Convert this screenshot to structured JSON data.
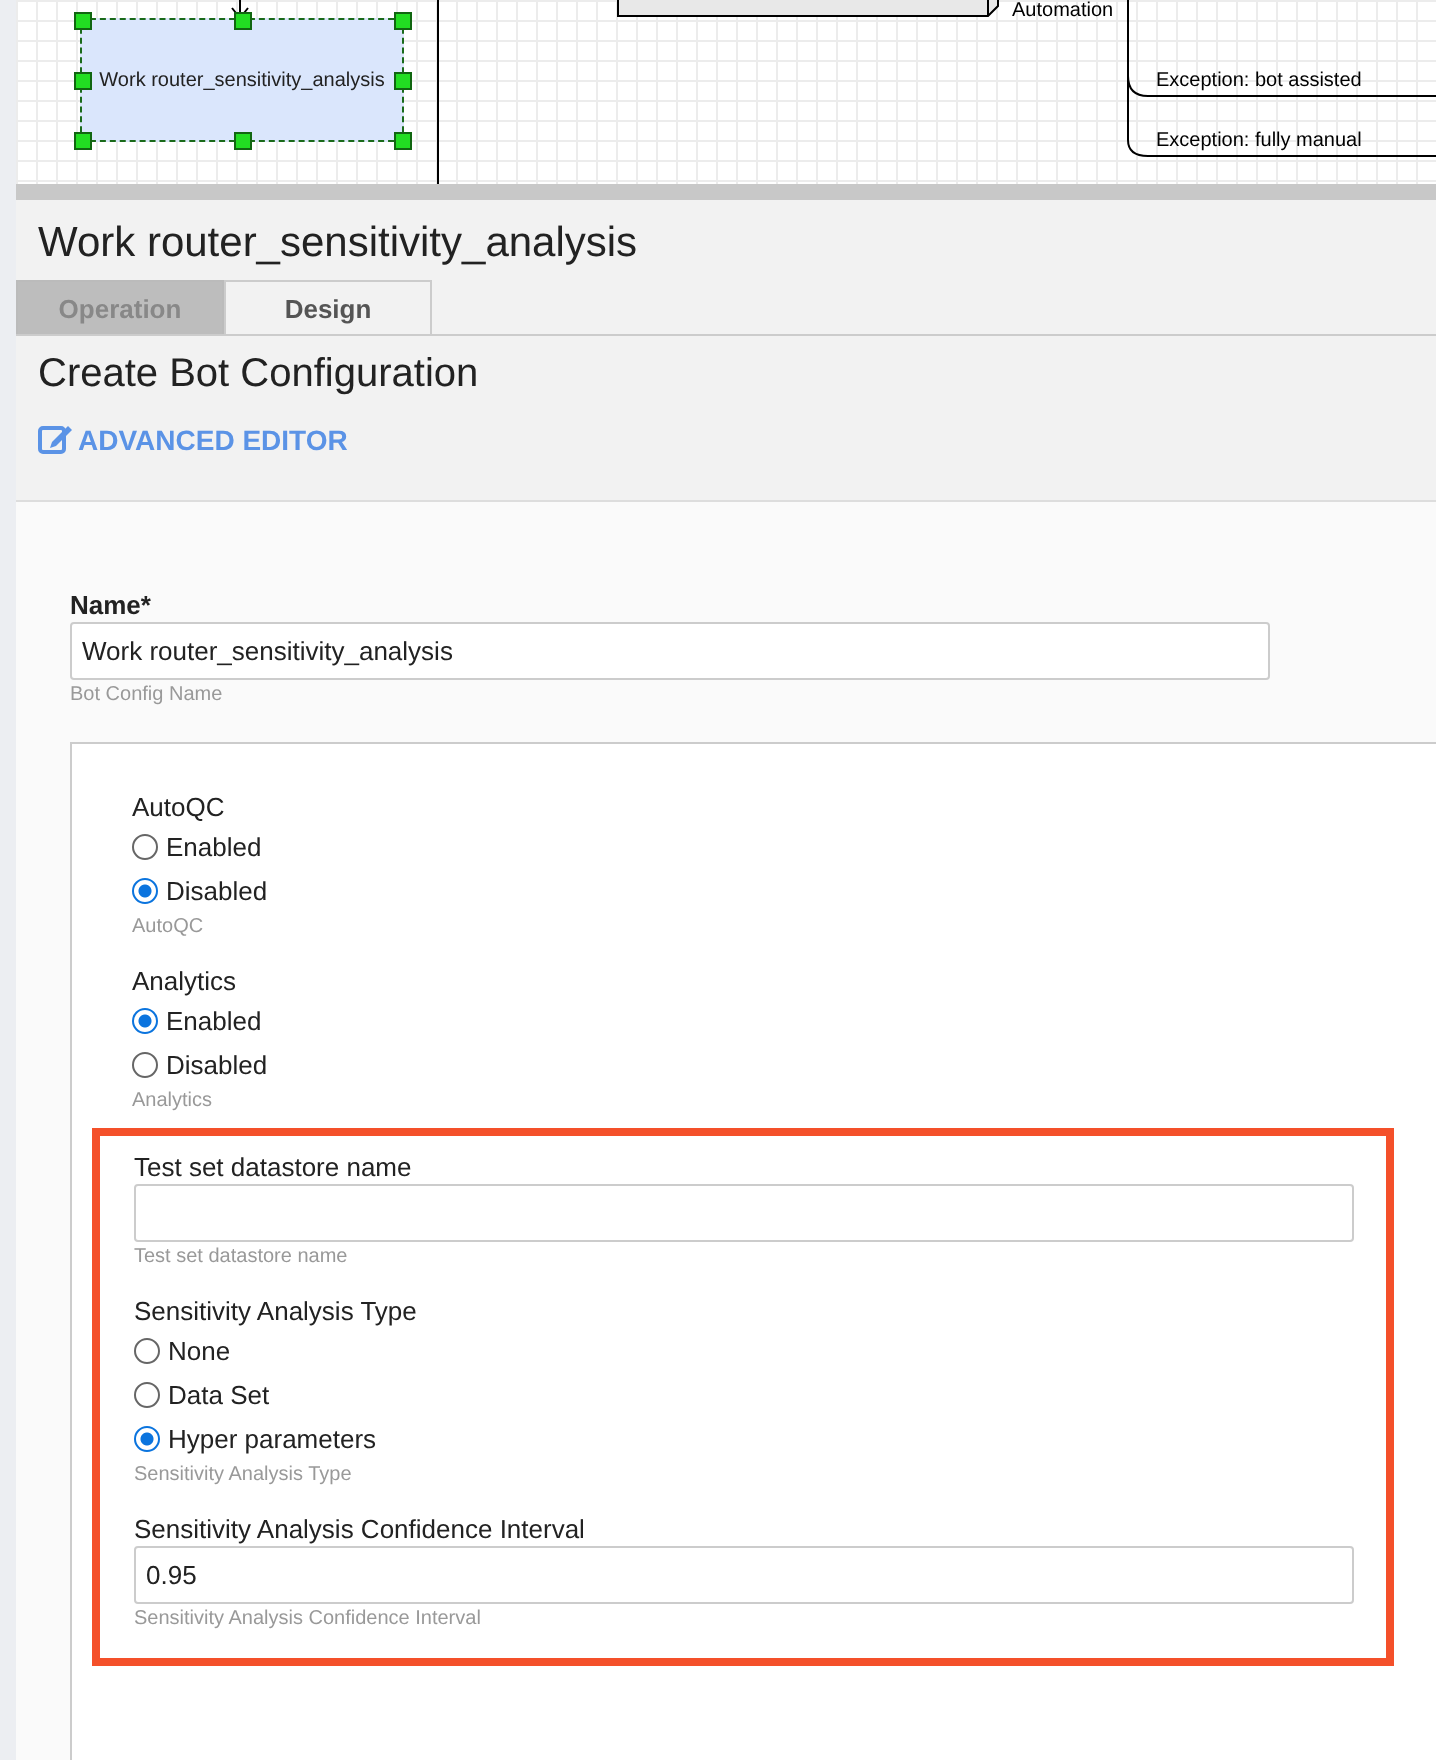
{
  "diagram": {
    "nodes": [
      {
        "label": "Work router_sensitivity_analysis",
        "selected": true
      }
    ],
    "labels": [
      "Automation"
    ],
    "branches": [
      "Exception: bot assisted",
      "Exception: fully manual"
    ]
  },
  "panel": {
    "title": "Work router_sensitivity_analysis",
    "tabs": [
      {
        "label": "Operation",
        "selected": false
      },
      {
        "label": "Design",
        "selected": true
      }
    ],
    "heading": "Create Bot Configuration",
    "advanced_editor": "ADVANCED EDITOR"
  },
  "name_field": {
    "label": "Name*",
    "value": "Work router_sensitivity_analysis",
    "help": "Bot Config Name"
  },
  "settings": [
    {
      "kind": "radio",
      "label": "AutoQC",
      "options": [
        {
          "label": "Enabled",
          "selected": false
        },
        {
          "label": "Disabled",
          "selected": true
        }
      ],
      "help": "AutoQC"
    },
    {
      "kind": "radio",
      "label": "Analytics",
      "options": [
        {
          "label": "Enabled",
          "selected": true
        },
        {
          "label": "Disabled",
          "selected": false
        }
      ],
      "help": "Analytics"
    }
  ],
  "highlighted_settings": [
    {
      "kind": "text",
      "label": "Test set datastore name",
      "help": "Test set datastore name"
    },
    {
      "kind": "radio",
      "label": "Sensitivity Analysis Type",
      "options": [
        {
          "label": "None",
          "selected": false
        },
        {
          "label": "Data Set",
          "selected": false
        },
        {
          "label": "Hyper parameters",
          "selected": true
        }
      ],
      "help": "Sensitivity Analysis Type"
    },
    {
      "kind": "text",
      "label": "Sensitivity Analysis Confidence Interval",
      "value": "0.95",
      "help": "Sensitivity Analysis Confidence Interval"
    }
  ]
}
